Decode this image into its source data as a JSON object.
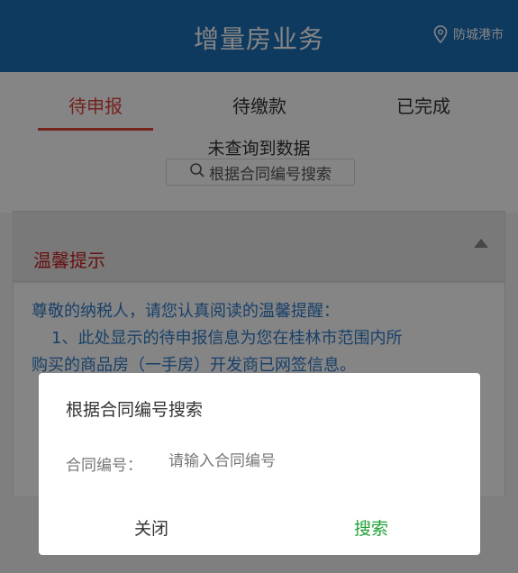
{
  "header": {
    "title": "增量房业务",
    "location": "防城港市",
    "location_icon": "location-pin-icon"
  },
  "tabs": [
    {
      "label": "待申报",
      "active": true
    },
    {
      "label": "待缴款",
      "active": false
    },
    {
      "label": "已完成",
      "active": false
    }
  ],
  "main": {
    "empty_text": "未查询到数据",
    "search_button": "根据合同编号搜索",
    "search_icon": "search-icon"
  },
  "tips": {
    "title": "温馨提示",
    "line1": "尊敬的纳税人，请您认真阅读的温馨提醒：",
    "line2": "1、此处显示的待申报信息为您在桂林市范围内所",
    "line3": "购买的商品房（一手房）开发商已网签信息。"
  },
  "dialog": {
    "title": "根据合同编号搜索",
    "field_label": "合同编号：",
    "field_placeholder": "请输入合同编号",
    "field_value": "",
    "close_label": "关闭",
    "search_label": "搜索"
  },
  "colors": {
    "header_bg": "#1d6fb6",
    "active_tab": "#e0443a",
    "tips_title": "#c81d1d",
    "tips_text": "#2f7bc8",
    "search_action": "#23a23a"
  }
}
